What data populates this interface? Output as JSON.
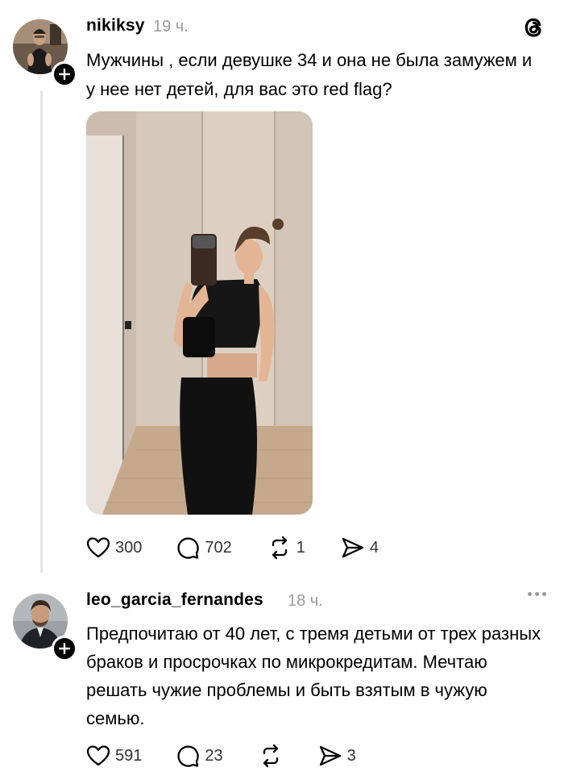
{
  "post": {
    "username": "nikiksy",
    "time": "19 ч.",
    "text": "Мужчины , если девушке 34 и она не была замужем и у нее нет детей, для вас это red flag?",
    "likes": "300",
    "replies": "702",
    "reposts": "1",
    "shares": "4"
  },
  "reply": {
    "username": "leo_garcia_fernandes",
    "time": "18 ч.",
    "text": "Предпочитаю от 40 лет, с тремя детьми от трех разных браков и просрочках по микрокредитам. Мечтаю решать чужие проблемы и быть взятым в чужую семью.",
    "likes": "591",
    "replies": "23",
    "shares": "3"
  },
  "icons": {
    "logo": "threads-logo-icon",
    "like": "heart-icon",
    "reply": "comment-icon",
    "repost": "repost-icon",
    "share": "send-icon",
    "more": "more-dots-icon",
    "follow": "plus-icon"
  },
  "colors": {
    "text": "#000000",
    "muted": "#9b9b9b",
    "thread_line": "#e5e5e5"
  }
}
